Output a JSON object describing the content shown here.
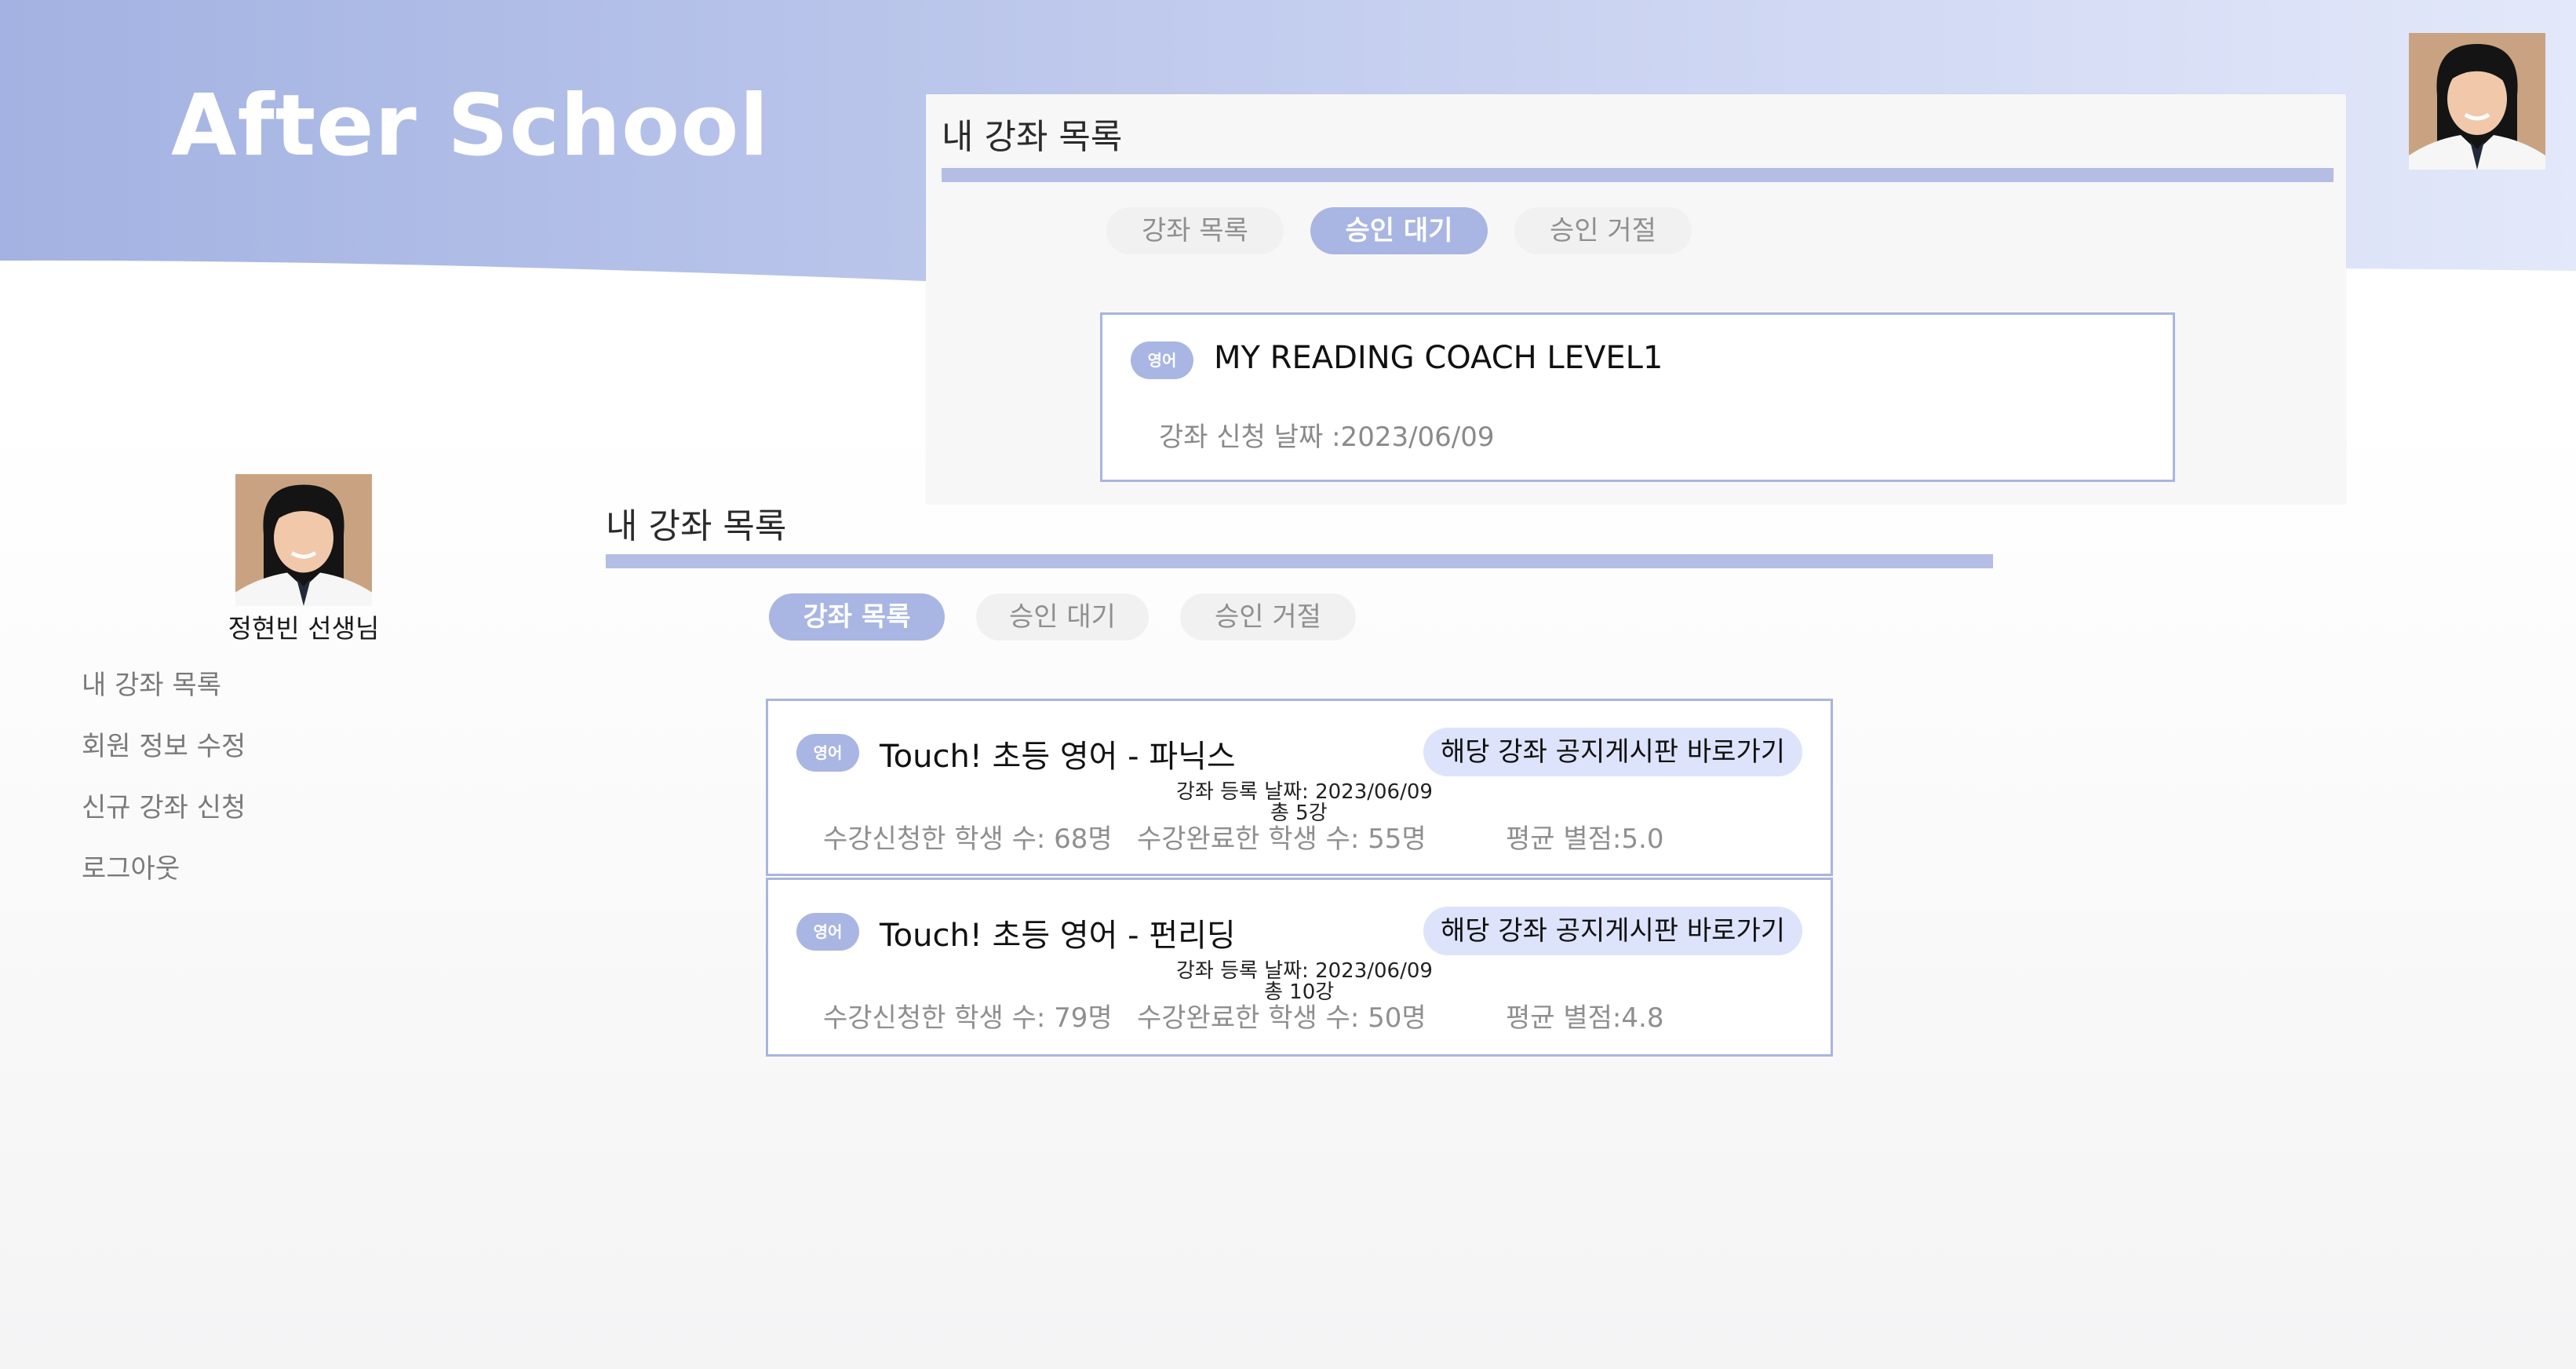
{
  "app": {
    "title": "After School"
  },
  "colors": {
    "accent": "#a9b5e2",
    "header_gradient_start": "#a3b2e2",
    "header_gradient_end": "#e3e8fa",
    "card_border": "#aab5de",
    "notice_button_bg": "#dde3fa"
  },
  "profile": {
    "name": "정현빈 선생님",
    "avatar_icon": "teacher-photo"
  },
  "sidebar": {
    "items": [
      {
        "label": "내 강좌 목록"
      },
      {
        "label": "회원 정보 수정"
      },
      {
        "label": "신규 강좌 신청"
      },
      {
        "label": "로그아웃"
      }
    ]
  },
  "pending_panel": {
    "title": "내 강좌 목록",
    "tabs": [
      {
        "label": "강좌 목록",
        "active": false
      },
      {
        "label": "승인 대기",
        "active": true
      },
      {
        "label": "승인 거절",
        "active": false
      }
    ],
    "course": {
      "subject": "영어",
      "name": "MY READING COACH LEVEL1",
      "applied_date": "강좌 신청 날짜 :2023/06/09"
    }
  },
  "main_panel": {
    "title": "내 강좌 목록",
    "tabs": [
      {
        "label": "강좌 목록",
        "active": true
      },
      {
        "label": "승인 대기",
        "active": false
      },
      {
        "label": "승인 거절",
        "active": false
      }
    ],
    "courses": [
      {
        "subject": "영어",
        "name": "Touch! 초등 영어 - 파닉스",
        "notice_button": "해당 강좌 공지게시판 바로가기",
        "registered": "강좌 등록 날짜: 2023/06/09",
        "total": "총 5강",
        "enrolled": "수강신청한 학생 수: 68명",
        "completed": "수강완료한 학생 수: 55명",
        "rating": "평균 별점:5.0"
      },
      {
        "subject": "영어",
        "name": "Touch! 초등 영어 - 펀리딩",
        "notice_button": "해당 강좌 공지게시판 바로가기",
        "registered": "강좌 등록 날짜: 2023/06/09",
        "total": "총 10강",
        "enrolled": "수강신청한 학생 수: 79명",
        "completed": "수강완료한 학생 수: 50명",
        "rating": "평균 별점:4.8"
      }
    ]
  }
}
